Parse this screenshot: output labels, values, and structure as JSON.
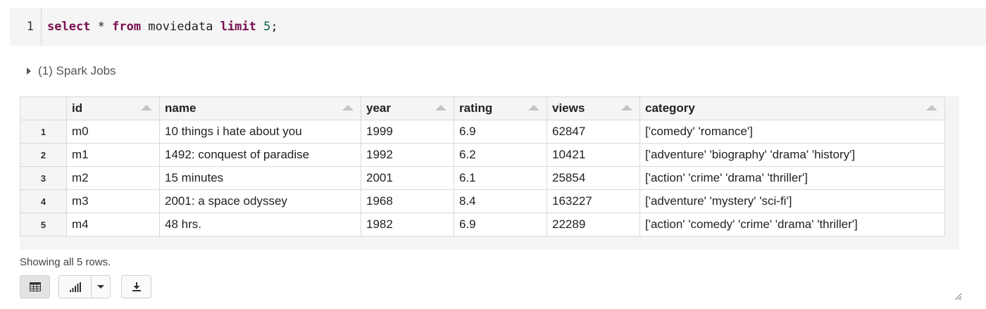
{
  "code": {
    "line_number": "1",
    "tokens": {
      "kw_select": "select",
      "star": " * ",
      "kw_from": "from",
      "table": " moviedata ",
      "kw_limit": "limit",
      "space": " ",
      "limit_value": "5",
      "semicolon": ";"
    }
  },
  "spark_jobs": {
    "label": "(1) Spark Jobs"
  },
  "table": {
    "columns": [
      "id",
      "name",
      "year",
      "rating",
      "views",
      "category"
    ],
    "rows": [
      {
        "index": "1",
        "cells": [
          "m0",
          "10 things i hate about you",
          "1999",
          "6.9",
          "62847",
          "['comedy' 'romance']"
        ]
      },
      {
        "index": "2",
        "cells": [
          "m1",
          "1492: conquest of paradise",
          "1992",
          "6.2",
          "10421",
          "['adventure' 'biography' 'drama' 'history']"
        ]
      },
      {
        "index": "3",
        "cells": [
          "m2",
          "15 minutes",
          "2001",
          "6.1",
          "25854",
          "['action' 'crime' 'drama' 'thriller']"
        ]
      },
      {
        "index": "4",
        "cells": [
          "m3",
          "2001: a space odyssey",
          "1968",
          "8.4",
          "163227",
          "['adventure' 'mystery' 'sci-fi']"
        ]
      },
      {
        "index": "5",
        "cells": [
          "m4",
          "48 hrs.",
          "1982",
          "6.9",
          "22289",
          "['action' 'comedy' 'crime' 'drama' 'thriller']"
        ]
      }
    ]
  },
  "footer": {
    "rows_note": "Showing all 5 rows.",
    "icons": {
      "table_view": "table-icon",
      "chart_view": "bar-chart-icon",
      "chart_options": "chevron-down-icon",
      "download": "download-icon"
    }
  },
  "colors": {
    "keyword": "#7a0e4f",
    "number": "#116644",
    "code_bg": "#f5f5f5",
    "grid_border": "#d9d9d9"
  }
}
